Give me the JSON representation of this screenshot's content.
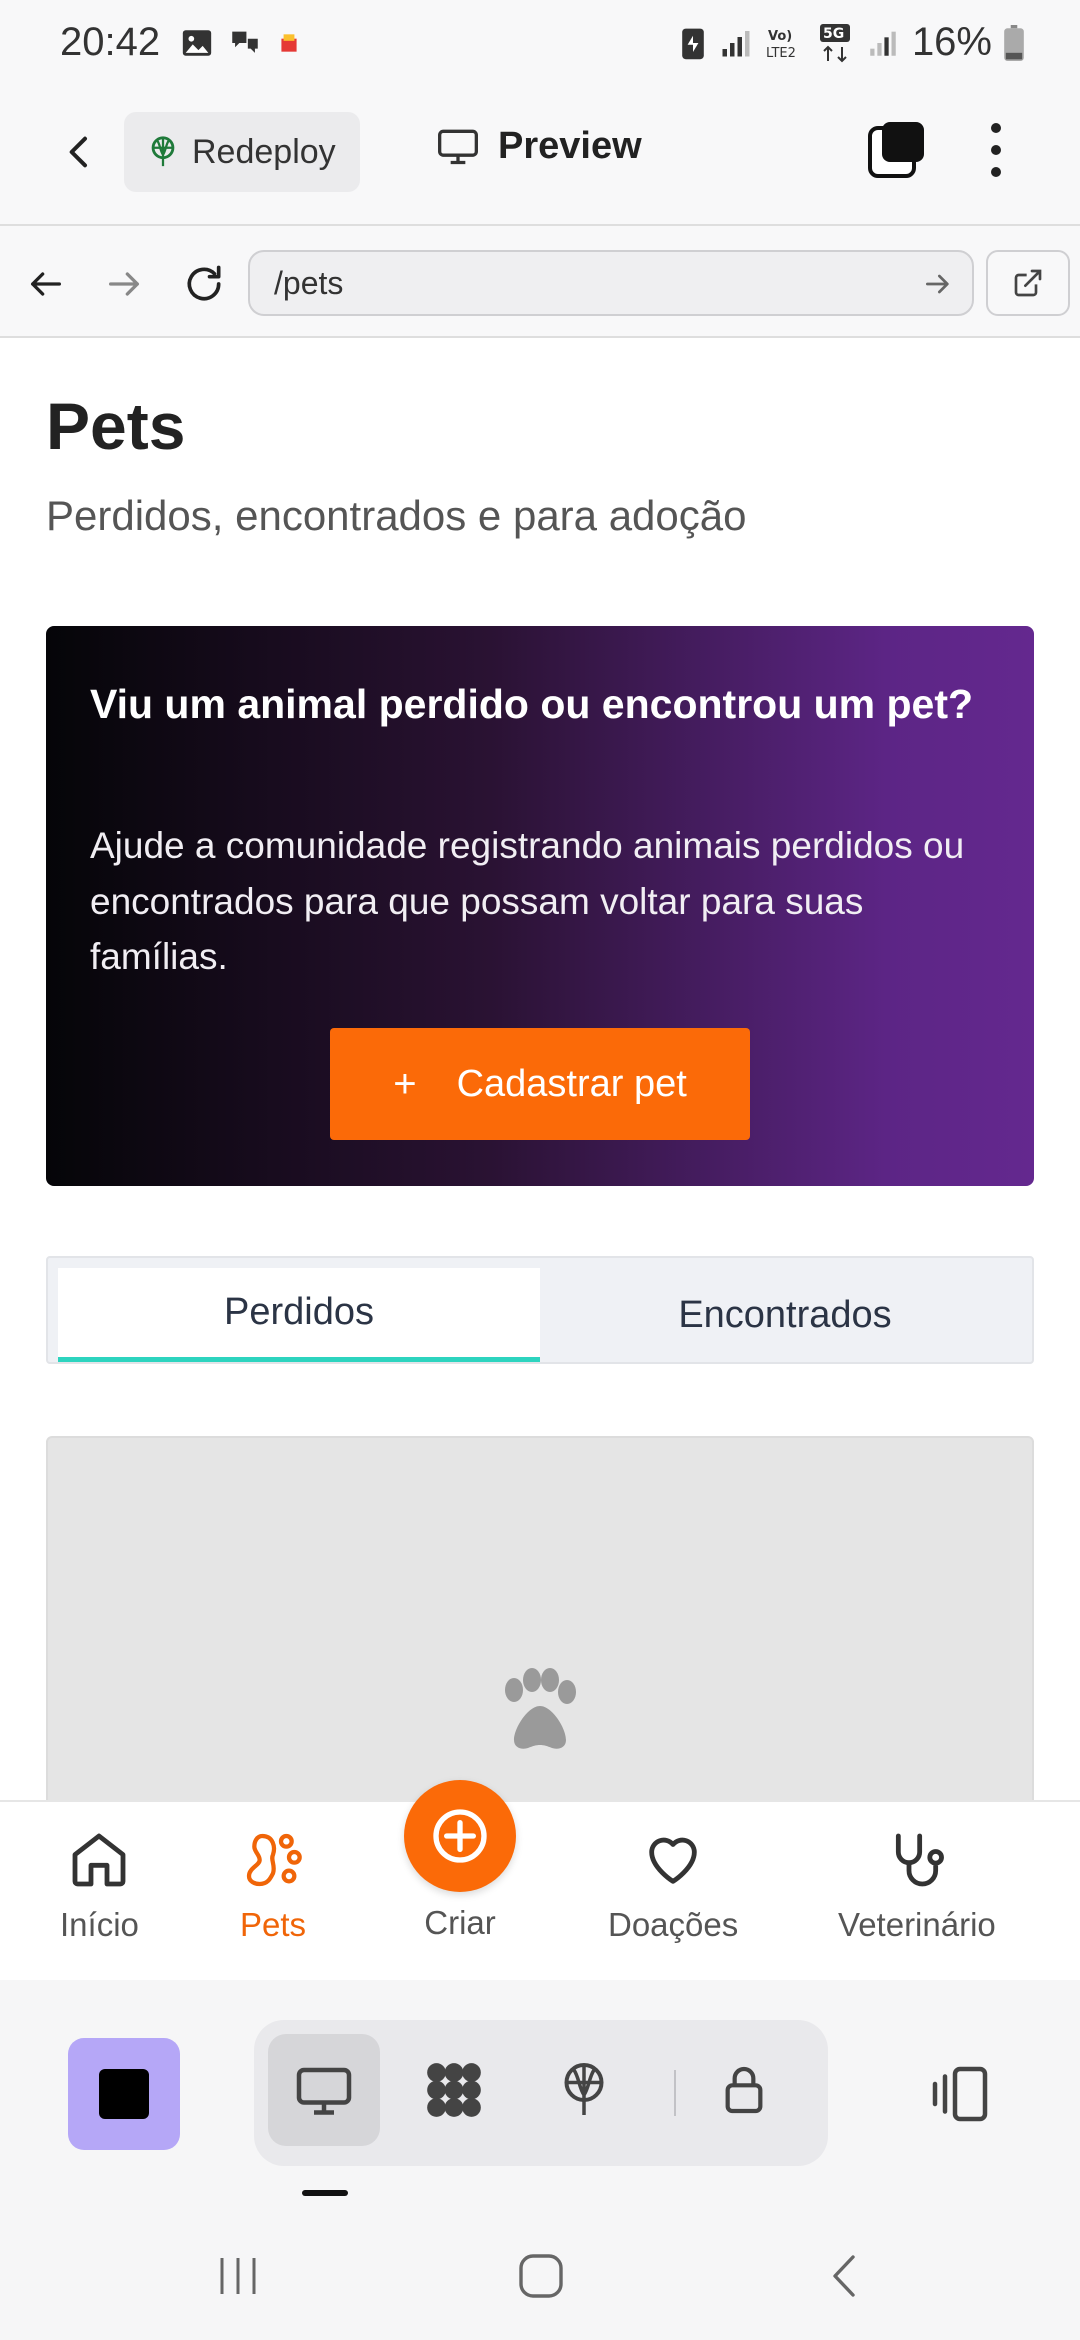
{
  "status_bar": {
    "time": "20:42",
    "battery": "16%"
  },
  "app_bar": {
    "redeploy_label": "Redeploy",
    "preview_label": "Preview"
  },
  "browser": {
    "url": "/pets"
  },
  "page": {
    "title": "Pets",
    "subtitle": "Perdidos, encontrados e para adoção"
  },
  "hero": {
    "title": "Viu um animal perdido ou encontrou um pet?",
    "text": "Ajude a comunidade registrando animais perdidos ou encontrados para que possam voltar para suas famílias.",
    "cta_plus": "+",
    "cta_label": "Cadastrar pet"
  },
  "tabs": [
    {
      "label": "Perdidos",
      "active": true
    },
    {
      "label": "Encontrados",
      "active": false
    }
  ],
  "bottom_nav": {
    "items": [
      {
        "label": "Início",
        "icon": "home-icon"
      },
      {
        "label": "Pets",
        "icon": "paw-icon",
        "active": true
      },
      {
        "label": "Criar",
        "icon": "plus-circle-icon"
      },
      {
        "label": "Doações",
        "icon": "heart-icon"
      },
      {
        "label": "Veterinário",
        "icon": "stethoscope-icon"
      }
    ]
  },
  "colors": {
    "accent": "#fb6a08",
    "tab_indicator": "#2dd4bf",
    "hero_gradient_end": "#64288f",
    "stop_button": "#b5a7f7"
  }
}
